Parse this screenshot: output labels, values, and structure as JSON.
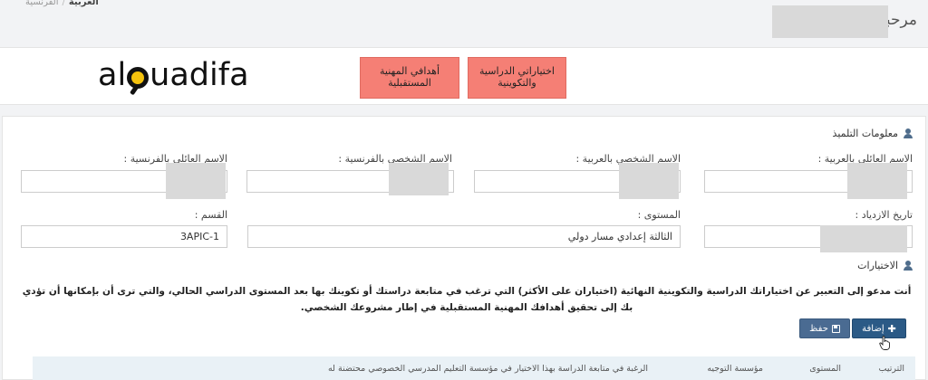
{
  "header": {
    "lang_active": "العربية",
    "lang_other": "الفرنسية",
    "greeting": "مرحبا"
  },
  "logo": {
    "text_before": "al",
    "text_after": "uadifa"
  },
  "nav": {
    "btn_choices": "اختياراتي الدراسية\nوالتكوينية",
    "btn_goals": "أهدافي المهنية\nالمستقبلية"
  },
  "student_info": {
    "title": "معلومات التلميذ",
    "labels": {
      "family_name_ar": "الاسم العائلي بالعربية :",
      "first_name_ar": "الاسم الشخصي بالعربية :",
      "first_name_fr": "الاسم الشخصي بالفرنسية :",
      "family_name_fr": "الاسم العائلي بالفرنسية :",
      "birth_date": "تاريخ الازدياد :",
      "level": "المستوى :",
      "class": "القسم :"
    },
    "values": {
      "level": "الثالثة إعدادي مسار دولي",
      "class": "3APIC-1"
    }
  },
  "choices": {
    "title": "الاختيارات",
    "intro": "أنت مدعو إلى التعبير عن اختياراتك الدراسية والتكوينية النهائية (اختياران على الأكثر) التي ترغب في متابعة دراستك أو تكوينك بها بعد المستوى الدراسي الحالي، والتي ترى أن بإمكانها أن تؤدي بك إلى تحقيق أهدافك المهنية المستقبلية في إطار مشروعك الشخصي.",
    "add_label": "إضافة",
    "save_label": "حفظ",
    "table_headers": [
      "الترتيب",
      "المستوى",
      "مؤسسة التوجيه",
      "الرغبة في متابعة الدراسة بهذا الاختيار في مؤسسة التعليم المدرسي الخصوصي محتضنة له"
    ]
  },
  "colors": {
    "nav_button": "#f57f75",
    "primary": "#2b5a86",
    "table_header_bg": "#e9f1f6"
  }
}
